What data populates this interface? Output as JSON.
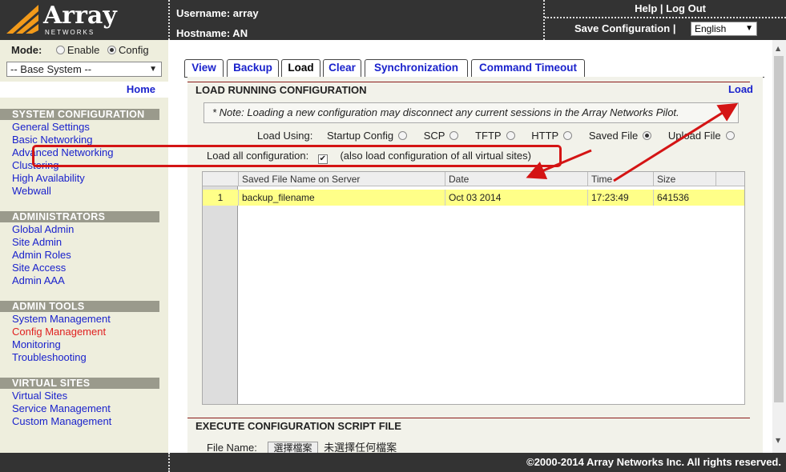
{
  "header": {
    "logo_text": "Array",
    "logo_sub": "NETWORKS",
    "username_label": "Username: array",
    "hostname_label": "Hostname: AN",
    "help_label": "Help",
    "logout_label": "Log Out",
    "save_config_label": "Save Configuration",
    "language_value": "English"
  },
  "sidebar": {
    "mode_label": "Mode:",
    "mode_enable": "Enable",
    "mode_config": "Config",
    "system_select": "-- Base System --",
    "home_label": "Home",
    "sections": [
      {
        "title": "SYSTEM CONFIGURATION",
        "items": [
          "General Settings",
          "Basic Networking",
          "Advanced Networking",
          "Clustering",
          "High Availability",
          "Webwall"
        ]
      },
      {
        "title": "ADMINISTRATORS",
        "items": [
          "Global Admin",
          "Site Admin",
          "Admin Roles",
          "Site Access",
          "Admin AAA"
        ]
      },
      {
        "title": "ADMIN TOOLS",
        "items": [
          "System Management",
          "Config Management",
          "Monitoring",
          "Troubleshooting"
        ]
      },
      {
        "title": "VIRTUAL SITES",
        "items": [
          "Virtual Sites",
          "Service Management",
          "Custom Management"
        ]
      }
    ]
  },
  "tabs": [
    "View",
    "Backup",
    "Load",
    "Clear",
    "Synchronization",
    "Command Timeout"
  ],
  "load_section": {
    "title": "LOAD RUNNING CONFIGURATION",
    "load_link": "Load",
    "note": "* Note: Loading a new configuration may disconnect any current sessions in the Array Networks Pilot.",
    "load_using_label": "Load Using:",
    "options": [
      "Startup Config",
      "SCP",
      "TFTP",
      "HTTP",
      "Saved File",
      "Upload File"
    ],
    "load_all_label": "Load all configuration:",
    "load_all_note": "(also load configuration of all virtual sites)"
  },
  "table": {
    "columns": [
      "Saved File Name on Server",
      "Date",
      "Time",
      "Size"
    ],
    "rows": [
      {
        "num": "1",
        "name": "backup_filename",
        "date": "Oct 03 2014",
        "time": "17:23:49",
        "size": "641536"
      }
    ]
  },
  "exec_section": {
    "title": "EXECUTE CONFIGURATION SCRIPT FILE",
    "file_name_label": "File Name:",
    "choose_button": "選擇檔案",
    "no_file_text": "未選擇任何檔案"
  },
  "footer": {
    "copyright": "©2000-2014 Array Networks Inc. All rights reserved."
  },
  "colors": {
    "topbar": "#333333",
    "sidebar": "#eeeedd",
    "link": "#1a22cc",
    "active_link": "#e02020",
    "highlight_row": "#ffff88",
    "annotation": "#d41414"
  }
}
